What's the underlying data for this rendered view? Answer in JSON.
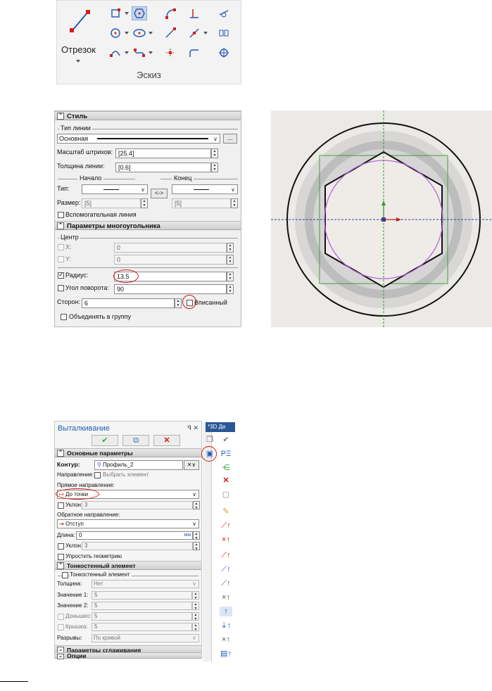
{
  "toolbar": {
    "segment_label": "Отрезок",
    "group_label": "Эскиз"
  },
  "style_panel": {
    "header": "Стиль",
    "line_type_group": "Тип линии",
    "line_type_value": "Основная",
    "browse_button": "...",
    "hatch_scale_label": "Масштаб штрихов:",
    "hatch_scale_value": "[25.4]",
    "line_width_label": "Толщина линии:",
    "line_width_value": "[0.6]",
    "start_label": "Начало",
    "end_label": "Конец",
    "type_label": "Тип:",
    "size_label": "Размер:",
    "start_size": "[5]",
    "end_size": "[5]",
    "swap_button": "<->",
    "aux_line_label": "Вспомогательная линия"
  },
  "polygon_panel": {
    "header": "Параметры многоугольника",
    "center_group": "Центр",
    "x_label": "X:",
    "x_value": "0",
    "y_label": "Y:",
    "y_value": "0",
    "radius_label": "Радиус:",
    "radius_value": "13.5",
    "rotation_label": "Угол поворота:",
    "rotation_value": "90",
    "sides_label": "Сторон:",
    "sides_value": "6",
    "inscribed_label": "Вписанный",
    "group_label": "Объединять в группу"
  },
  "extrude_panel": {
    "title": "Выталкивание",
    "pin": "ꟼ ✕",
    "main_params_header": "Основные параметры",
    "contour_label": "Контур:",
    "contour_value": "Профиль_2",
    "direction_label": "Направление:",
    "direction_placeholder": "Выбрать элемент",
    "forward_label": "Прямое направление:",
    "forward_value": "До точки",
    "slope1_label": "Уклон:",
    "slope1_value": "3",
    "reverse_label": "Обратное направление:",
    "reverse_value": "Отступ",
    "length_label": "Длина:",
    "length_value": "0",
    "length_unit": "мм",
    "slope2_label": "Уклон:",
    "slope2_value": "3",
    "simplify_label": "Упростить геометрию",
    "thin_header": "Тонкостенный элемент",
    "thin_group": "Тонкостенный элемент",
    "thickness_label": "Толщина:",
    "thickness_value": "Нет",
    "value1_label": "Значение 1:",
    "value1": "5",
    "value2_label": "Значение 2:",
    "value2": "5",
    "bottom_label": "Донышко:",
    "bottom_value": "5",
    "lid_label": "Крышка:",
    "lid_value": "5",
    "gaps_label": "Разрывы:",
    "gaps_value": "По кривой",
    "smoothing_header": "Параметры сглаживания",
    "options_header": "Опции"
  },
  "side_toolbar": {
    "doc_tab": "*3D Де"
  },
  "colors": {
    "accent_blue": "#1f5fb0",
    "annotation_red": "#d01818",
    "axis_green": "#2e9a2e",
    "axis_blue": "#2a3f9a"
  }
}
